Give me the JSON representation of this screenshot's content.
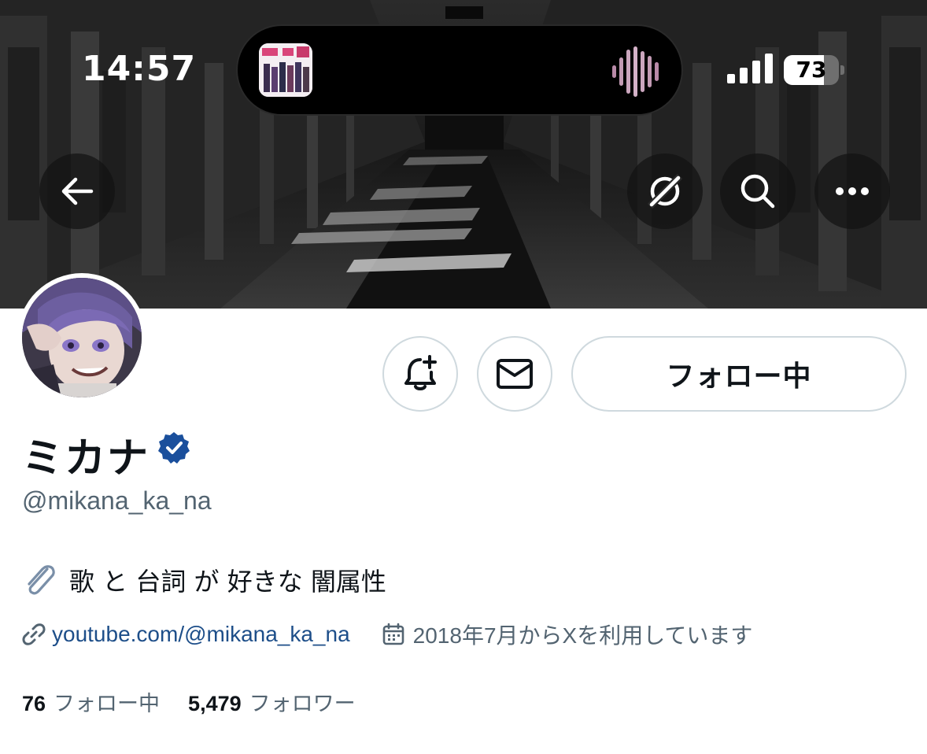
{
  "status_bar": {
    "time": "14:57",
    "battery_level": 73,
    "battery_text": "73",
    "signal_bars": 4
  },
  "nav": {
    "back_icon": "arrow-left-icon",
    "grok_icon": "grok-icon",
    "search_icon": "search-icon",
    "more_icon": "more-horizontal-icon"
  },
  "actions": {
    "notify_icon": "bell-plus-icon",
    "message_icon": "envelope-icon",
    "follow_label": "フォロー中"
  },
  "profile": {
    "display_name": "ミカナ",
    "verified": true,
    "handle": "@mikana_ka_na",
    "bio": "歌 と 台詞 が 好きな 闇属性",
    "bio_icon": "paperclip-icon",
    "link": "youtube.com/@mikana_ka_na",
    "joined": "2018年7月からXを利用しています"
  },
  "stats": {
    "following_count": "76",
    "following_label": "フォロー中",
    "followers_count": "5,479",
    "followers_label": "フォロワー"
  },
  "colors": {
    "text_primary": "#0f1419",
    "text_secondary": "#536471",
    "link": "#1d4e89",
    "verified_badge": "#1a4f9c",
    "button_border": "#cfd9de"
  }
}
